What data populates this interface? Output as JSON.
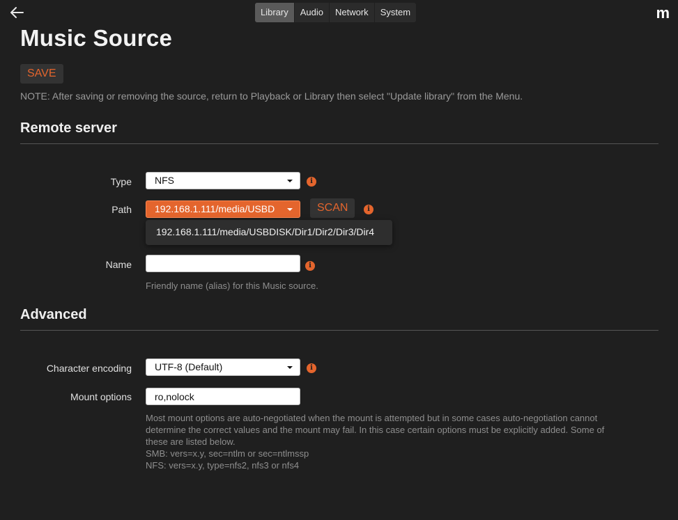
{
  "header": {
    "tabs": [
      {
        "label": "Library",
        "active": true
      },
      {
        "label": "Audio",
        "active": false
      },
      {
        "label": "Network",
        "active": false
      },
      {
        "label": "System",
        "active": false
      }
    ],
    "logo": "m",
    "back_icon": "arrow-left-icon"
  },
  "page": {
    "title": "Music Source",
    "save_label": "SAVE",
    "note": "NOTE: After saving or removing the source, return to Playback or Library then select \"Update library\" from the Menu."
  },
  "remote_server": {
    "section_title": "Remote server",
    "type": {
      "label": "Type",
      "value": "NFS"
    },
    "path": {
      "label": "Path",
      "value": "192.168.1.111/media/USBD",
      "scan_label": "SCAN",
      "options": [
        "192.168.1.111/media/USBDISK/Dir1/Dir2/Dir3/Dir4"
      ]
    },
    "name": {
      "label": "Name",
      "value": "",
      "help": "Friendly name (alias) for this Music source."
    }
  },
  "advanced": {
    "section_title": "Advanced",
    "encoding": {
      "label": "Character encoding",
      "value": "UTF-8 (Default)"
    },
    "mount_options": {
      "label": "Mount options",
      "value": "ro,nolock",
      "help_lines": [
        "Most mount options are auto-negotiated when the mount is attempted but in some cases auto-negotiation cannot",
        "determine the correct values and the mount may fail. In this case certain options must be explicitly added. Some of",
        "these are listed below.",
        "SMB: vers=x.y, sec=ntlm or sec=ntlmssp",
        "NFS: vers=x.y, type=nfs2, nfs3 or nfs4"
      ]
    }
  },
  "colors": {
    "accent": "#e4652d",
    "background": "#1f1f1f",
    "muted_text": "#9a9a9a"
  }
}
